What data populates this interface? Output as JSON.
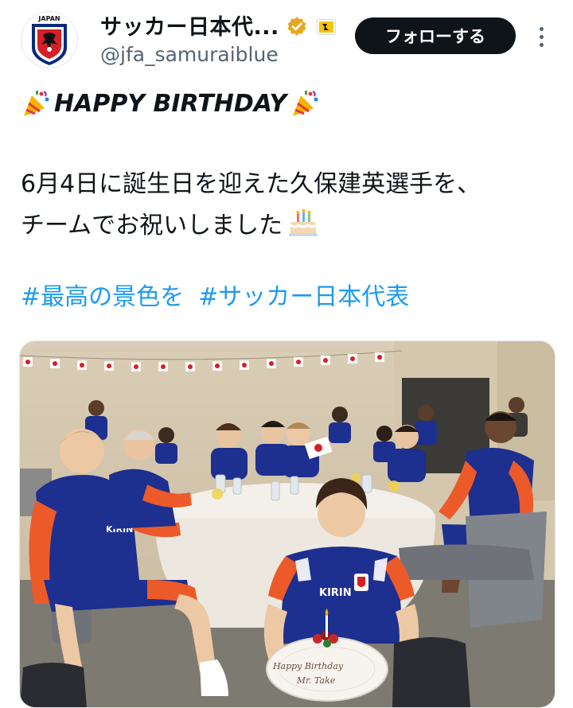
{
  "account": {
    "display_name": "サッカー日本代...",
    "handle": "@jfa_samuraiblue",
    "avatar_text": "JAPAN"
  },
  "actions": {
    "follow_label": "フォローする"
  },
  "tweet": {
    "birthday_heading": "HAPPY BIRTHDAY",
    "line1": "6月4日に誕生日を迎えた久保建英選手を、",
    "line2": "チームでお祝いしました",
    "hashtags": [
      "#最高の景色を",
      "#サッカー日本代表"
    ]
  },
  "photo": {
    "plate_text_1": "Happy Birthday",
    "plate_text_2": "Mr. Take"
  },
  "colors": {
    "hashtag": "#1d9bf0",
    "jersey_blue": "#1d2f8f",
    "jersey_orange": "#ec5a2a",
    "verified_gold": "#e5a823"
  },
  "icons": [
    "party-popper-icon",
    "cake-icon",
    "verified-badge-icon",
    "affiliate-badge-icon",
    "more-options-icon"
  ]
}
